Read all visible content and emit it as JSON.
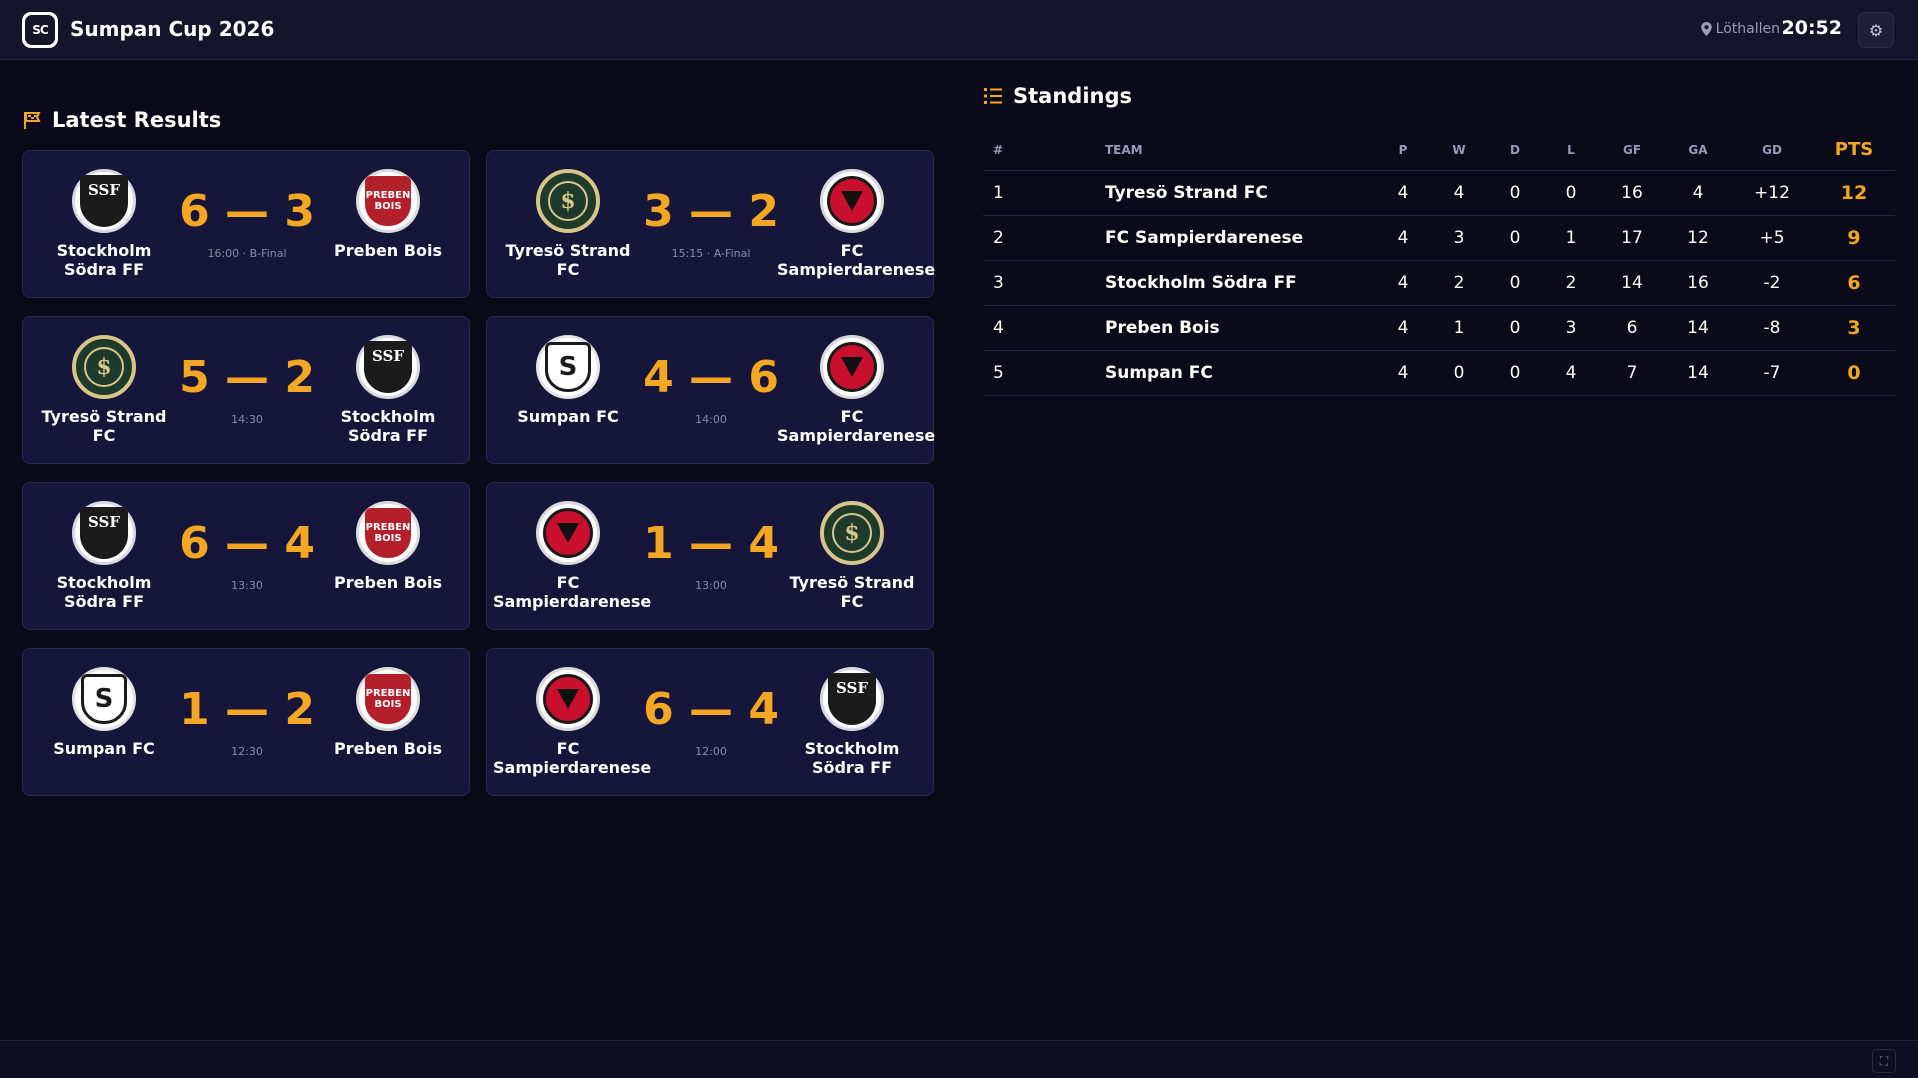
{
  "header": {
    "logo_text": "SC",
    "title": "Sumpan Cup 2026",
    "venue": "Löthallen",
    "time": "20:52",
    "settings_icon": "gear-icon"
  },
  "colors": {
    "accent": "#f5a623",
    "background": "#0b0a1a",
    "card": "#16163a"
  },
  "results": {
    "title": "Latest Results",
    "icon": "flag-icon",
    "matches": [
      {
        "home": "Stockholm Södra FF",
        "home_crest": "ssf",
        "score": "6 — 3",
        "away": "Preben Bois",
        "away_crest": "pb",
        "meta": "16:00 · B-Final"
      },
      {
        "home": "Tyresö Strand FC",
        "home_crest": "tyr",
        "score": "3 — 2",
        "away": "FC Sampierdarenese",
        "away_crest": "fcs",
        "meta": "15:15 · A-Final"
      },
      {
        "home": "Tyresö Strand FC",
        "home_crest": "tyr",
        "score": "5 — 2",
        "away": "Stockholm Södra FF",
        "away_crest": "ssf",
        "meta": "14:30"
      },
      {
        "home": "Sumpan FC",
        "home_crest": "sfc",
        "score": "4 — 6",
        "away": "FC Sampierdarenese",
        "away_crest": "fcs",
        "meta": "14:00"
      },
      {
        "home": "Stockholm Södra FF",
        "home_crest": "ssf",
        "score": "6 — 4",
        "away": "Preben Bois",
        "away_crest": "pb",
        "meta": "13:30"
      },
      {
        "home": "FC Sampierdarenese",
        "home_crest": "fcs",
        "score": "1 — 4",
        "away": "Tyresö Strand FC",
        "away_crest": "tyr",
        "meta": "13:00"
      },
      {
        "home": "Sumpan FC",
        "home_crest": "sfc",
        "score": "1 — 2",
        "away": "Preben Bois",
        "away_crest": "pb",
        "meta": "12:30"
      },
      {
        "home": "FC Sampierdarenese",
        "home_crest": "fcs",
        "score": "6 — 4",
        "away": "Stockholm Södra FF",
        "away_crest": "ssf",
        "meta": "12:00"
      }
    ]
  },
  "standings": {
    "title": "Standings",
    "icon": "list-icon",
    "columns": [
      "#",
      "TEAM",
      "P",
      "W",
      "D",
      "L",
      "GF",
      "GA",
      "GD",
      "PTS"
    ],
    "rows": [
      [
        "1",
        "Tyresö Strand FC",
        "4",
        "4",
        "0",
        "0",
        "16",
        "4",
        "+12",
        "12"
      ],
      [
        "2",
        "FC Sampierdarenese",
        "4",
        "3",
        "0",
        "1",
        "17",
        "12",
        "+5",
        "9"
      ],
      [
        "3",
        "Stockholm Södra FF",
        "4",
        "2",
        "0",
        "2",
        "14",
        "16",
        "-2",
        "6"
      ],
      [
        "4",
        "Preben Bois",
        "4",
        "1",
        "0",
        "3",
        "6",
        "14",
        "-8",
        "3"
      ],
      [
        "5",
        "Sumpan FC",
        "4",
        "0",
        "0",
        "4",
        "7",
        "14",
        "-7",
        "0"
      ]
    ]
  },
  "footer": {
    "fullscreen_icon": "fullscreen-icon"
  }
}
